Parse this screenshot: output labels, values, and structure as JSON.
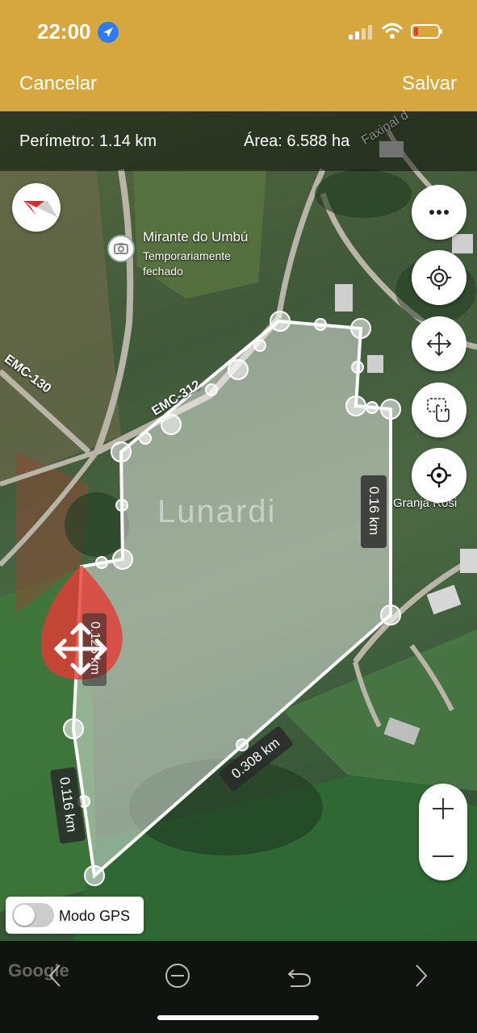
{
  "status_bar": {
    "time": "22:00"
  },
  "header": {
    "cancel_label": "Cancelar",
    "save_label": "Salvar"
  },
  "info_bar": {
    "perimeter": "Perímetro: 1.14 km",
    "area": "Área: 6.588 ha"
  },
  "map": {
    "poi": {
      "title": "Mirante do Umbú",
      "subtitle": "Temporariamente fechado"
    },
    "road_labels": [
      "EMC-130",
      "EMC-312",
      "Faxinal d"
    ],
    "place_labels": [
      "Granja Rosi"
    ],
    "watermark": "Lunardi",
    "attribution": "Google",
    "segment_labels": [
      "0.16 km",
      "0.308 km",
      "0.116 km",
      "0.126 km"
    ]
  },
  "controls": {
    "gps_mode_label": "Modo GPS",
    "gps_mode_on": false,
    "fab_icons": [
      "more-icon",
      "locate-icon",
      "move-icon",
      "touch-icon",
      "crosshair-icon"
    ],
    "zoom_in": "+",
    "zoom_out": "−"
  },
  "bottom_bar": {
    "icons": [
      "previous-icon",
      "remove-icon",
      "undo-icon",
      "next-icon"
    ]
  },
  "colors": {
    "header": "#d6a73e",
    "polygon_fill": "#ffffff",
    "vertex_handle": "#e53935"
  }
}
